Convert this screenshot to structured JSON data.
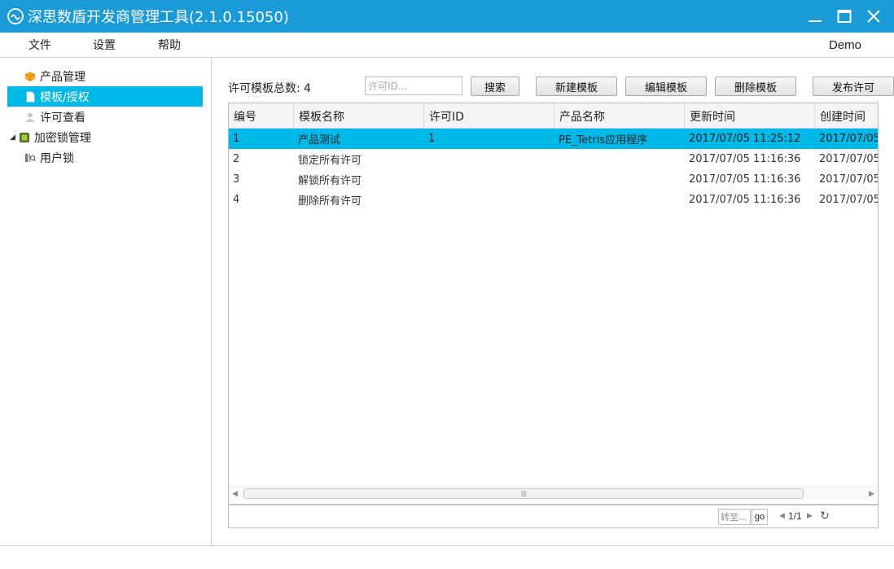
{
  "window": {
    "title": "深思数盾开发商管理工具(2.1.0.15050)"
  },
  "menu": {
    "items": [
      "文件",
      "设置",
      "帮助"
    ],
    "user": "Demo"
  },
  "sidebar": {
    "items": [
      {
        "label": "产品管理",
        "icon": "box-icon"
      },
      {
        "label": "模板/授权",
        "icon": "document-icon",
        "selected": true
      },
      {
        "label": "许可查看",
        "icon": "user-icon"
      },
      {
        "label": "加密锁管理",
        "icon": "chip-icon",
        "expanded": true
      },
      {
        "label": "用户锁",
        "icon": "usb-lock-icon"
      }
    ]
  },
  "toolbar": {
    "total_label": "许可模板总数: 4",
    "search_placeholder": "许可ID...",
    "search_button": "搜索",
    "new_button": "新建模板",
    "edit_button": "编辑模板",
    "delete_button": "删除模板",
    "publish_button": "发布许可"
  },
  "table": {
    "columns": [
      "编号",
      "模板名称",
      "许可ID",
      "产品名称",
      "更新时间",
      "创建时间"
    ],
    "rows": [
      [
        "1",
        "产品测试",
        "1",
        "PE_Tetris应用程序",
        "2017/07/05 11:25:12",
        "2017/07/05"
      ],
      [
        "2",
        "锁定所有许可",
        "",
        "",
        "2017/07/05 11:16:36",
        "2017/07/05"
      ],
      [
        "3",
        "解锁所有许可",
        "",
        "",
        "2017/07/05 11:16:36",
        "2017/07/05"
      ],
      [
        "4",
        "删除所有许可",
        "",
        "",
        "2017/07/05 11:16:36",
        "2017/07/05"
      ]
    ],
    "selected_row": 0
  },
  "pager": {
    "goto_placeholder": "转至...",
    "go_label": "go",
    "page_info": "1/1"
  },
  "colors": {
    "titlebar": "#1a9ad6",
    "selection": "#00b9e8"
  }
}
